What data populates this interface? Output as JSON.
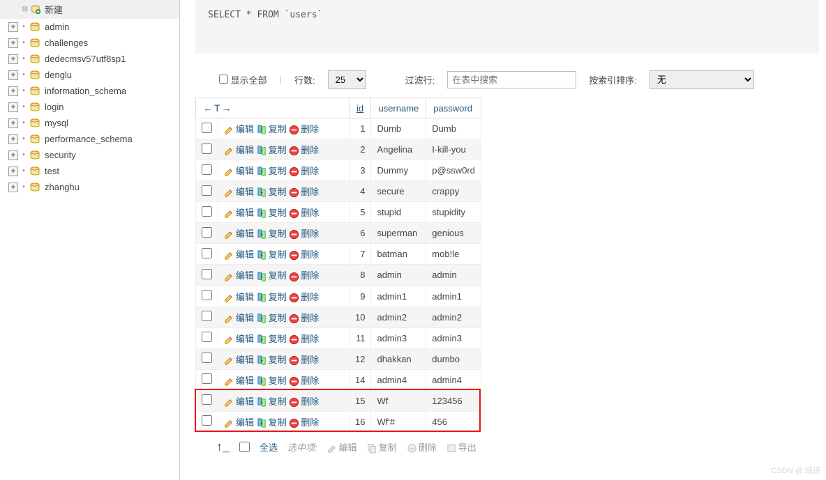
{
  "sidebar": {
    "new_item": "新建",
    "databases": [
      "admin",
      "challenges",
      "dedecmsv57utf8sp1",
      "denglu",
      "information_schema",
      "login",
      "mysql",
      "performance_schema",
      "security",
      "test",
      "zhanghu"
    ]
  },
  "sql": "SELECT * FROM `users`",
  "toolbar": {
    "show_all": "显示全部",
    "rows_label": "行数:",
    "rows_value": "25",
    "filter_label": "过滤行:",
    "filter_placeholder": "在表中搜索",
    "sort_label": "按索引排序:",
    "sort_value": "无"
  },
  "table": {
    "arrow_header": "←T→",
    "columns": [
      "id",
      "username",
      "password"
    ],
    "action_labels": {
      "edit": "编辑",
      "copy": "复制",
      "delete": "删除"
    },
    "rows": [
      {
        "id": "1",
        "username": "Dumb",
        "password": "Dumb"
      },
      {
        "id": "2",
        "username": "Angelina",
        "password": "I-kill-you"
      },
      {
        "id": "3",
        "username": "Dummy",
        "password": "p@ssw0rd"
      },
      {
        "id": "4",
        "username": "secure",
        "password": "crappy"
      },
      {
        "id": "5",
        "username": "stupid",
        "password": "stupidity"
      },
      {
        "id": "6",
        "username": "superman",
        "password": "genious"
      },
      {
        "id": "7",
        "username": "batman",
        "password": "mob!le"
      },
      {
        "id": "8",
        "username": "admin",
        "password": "admin"
      },
      {
        "id": "9",
        "username": "admin1",
        "password": "admin1"
      },
      {
        "id": "10",
        "username": "admin2",
        "password": "admin2"
      },
      {
        "id": "11",
        "username": "admin3",
        "password": "admin3"
      },
      {
        "id": "12",
        "username": "dhakkan",
        "password": "dumbo"
      },
      {
        "id": "14",
        "username": "admin4",
        "password": "admin4"
      },
      {
        "id": "15",
        "username": "Wf",
        "password": "123456"
      },
      {
        "id": "16",
        "username": "Wf'#",
        "password": "456"
      }
    ]
  },
  "footer": {
    "check_all": "全选",
    "selected_label": "选中项:",
    "edit": "编辑",
    "copy": "复制",
    "delete": "删除",
    "export": "导出"
  },
  "highlight": {
    "first_id": "15",
    "last_id": "16"
  },
  "watermark": "CSDN @.琼琼"
}
